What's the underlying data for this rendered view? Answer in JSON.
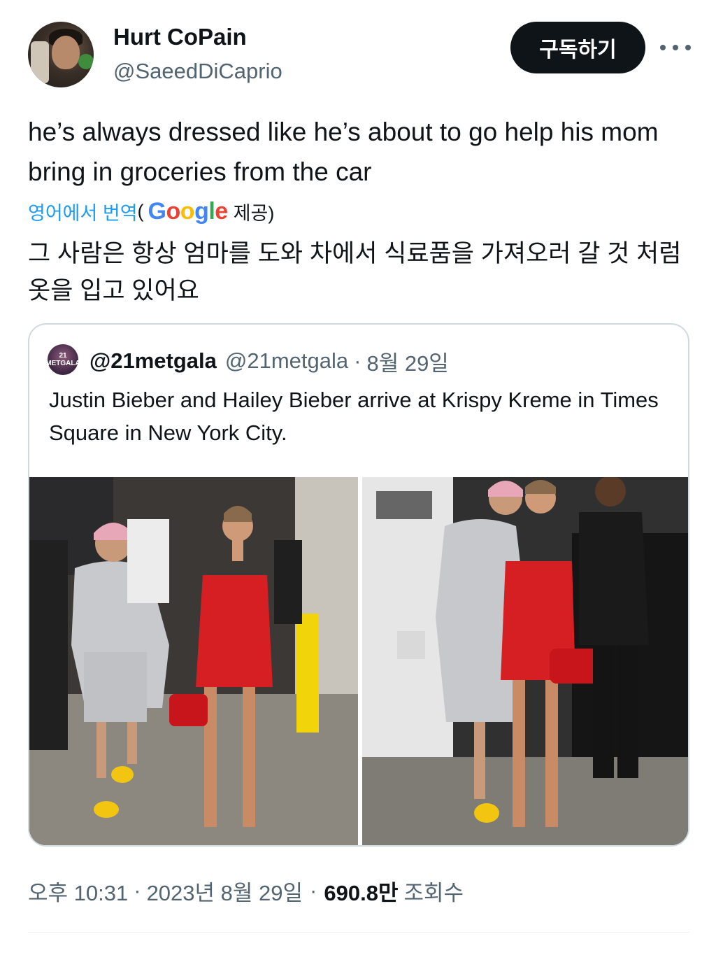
{
  "author": {
    "display_name": "Hurt CoPain",
    "handle": "@SaeedDiCaprio",
    "avatar_icon": "user-avatar"
  },
  "subscribe_label": "구독하기",
  "more_icon": "more-options-icon",
  "tweet": {
    "text": "he’s always dressed like he’s about to go help his mom bring in groceries from the car",
    "translate_link": "영어에서 번역",
    "translate_open": "(",
    "google_letters": [
      "G",
      "o",
      "o",
      "g",
      "l",
      "e"
    ],
    "translate_provider_suffix": "제공)",
    "translated_text": "그 사람은 항상 엄마를 도와 차에서 식료품을 가져오러 갈 것 처럼 옷을 입고 있어요"
  },
  "quote": {
    "avatar_text": "21 METGALA",
    "display_name": "@21metgala",
    "handle": "@21metgala",
    "separator": "·",
    "date": "8월 29일",
    "text": "Justin Bieber and Hailey Bieber arrive at Krispy Kreme in Times Square in New York City.",
    "photos": [
      "photo-left",
      "photo-right"
    ]
  },
  "footer": {
    "time": "오후 10:31",
    "sep1": "·",
    "date": "2023년 8월 29일",
    "sep2": "·",
    "views_count": "690.8만",
    "views_label": "조회수"
  },
  "colors": {
    "text_primary": "#0f1419",
    "text_secondary": "#536471",
    "link": "#1d9bf0",
    "border": "#cfd9de",
    "button_bg": "#0f1419",
    "dress_red": "#d51f23",
    "clog_yellow": "#f2c511"
  }
}
